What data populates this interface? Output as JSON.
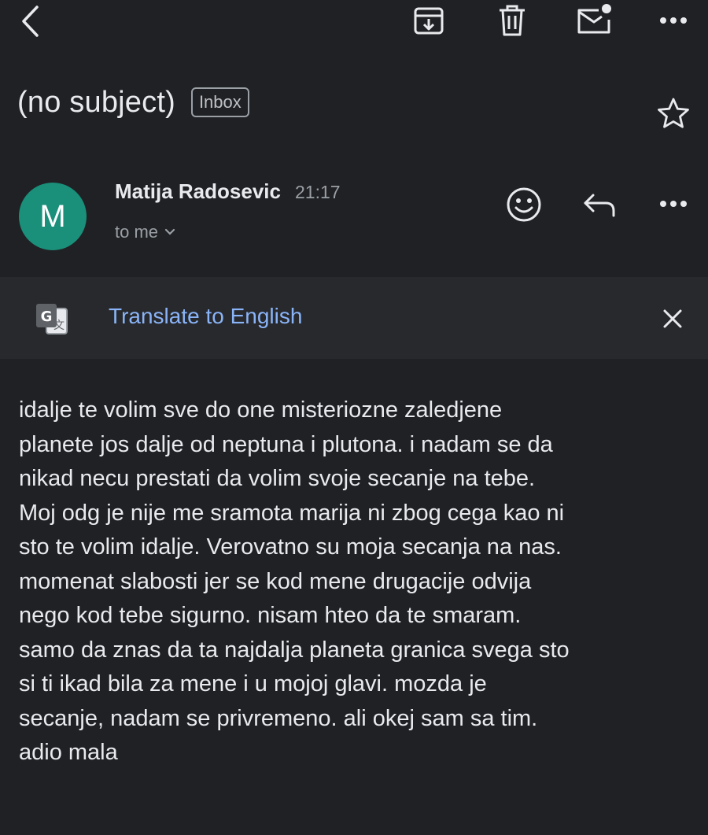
{
  "colors": {
    "background": "#202124",
    "translate_bar": "#28292c",
    "avatar": "#1a8f7a",
    "link": "#8ab4f8",
    "secondary_text": "#9aa0a6"
  },
  "toolbar": {
    "icons": [
      "back-arrow-icon",
      "archive-icon",
      "trash-icon",
      "mark-unread-icon",
      "more-vert-icon"
    ]
  },
  "message": {
    "subject": "(no subject)",
    "label": "Inbox",
    "sender": {
      "avatar_letter": "M",
      "name": "Matija Radosevic",
      "time": "21:17",
      "recipient": "to me"
    }
  },
  "translate": {
    "link_text": "Translate to English"
  },
  "body": {
    "lines": [
      "idalje te volim sve do one misteriozne zaledjene",
      "planete jos dalje od neptuna i plutona. i nadam se da",
      "nikad necu prestati da volim svoje secanje na tebe.",
      "Moj odg je nije me sramota marija ni zbog cega kao ni",
      "sto te volim idalje. Verovatno su moja secanja na nas.",
      "momenat slabosti jer se kod mene drugacije odvija",
      "nego kod tebe sigurno. nisam hteo da te smaram.",
      "samo da znas da ta najdalja planeta granica svega sto",
      "si ti ikad bila za mene i u mojoj glavi. mozda je",
      "secanje, nadam se privremeno. ali okej sam sa tim.",
      "adio mala"
    ]
  }
}
